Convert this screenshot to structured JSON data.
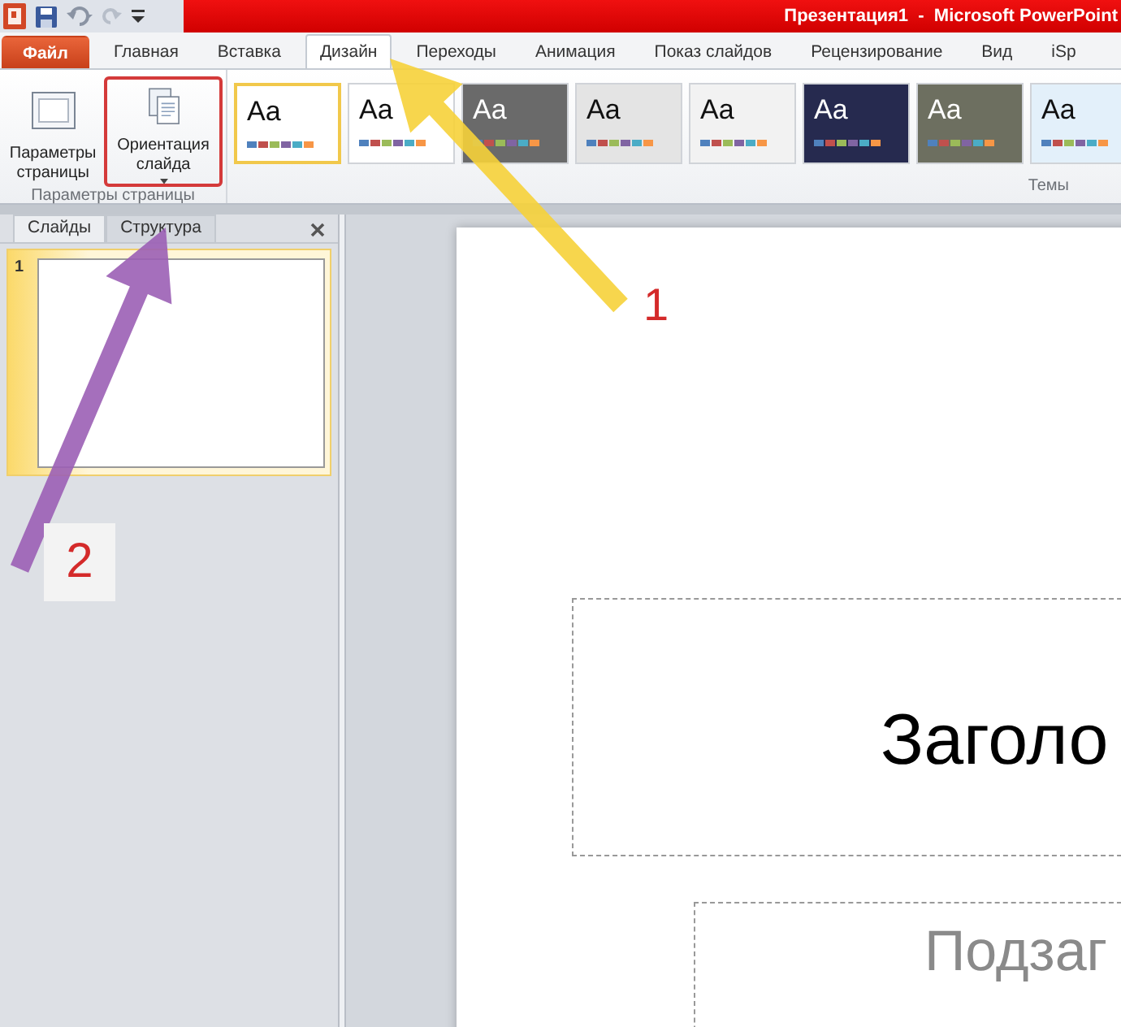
{
  "title_bar": {
    "title": "Презентация1  -  Microsoft PowerPoint"
  },
  "tabs": [
    {
      "label": "Файл",
      "kind": "file",
      "selected": false
    },
    {
      "label": "Главная",
      "kind": "tab",
      "selected": false
    },
    {
      "label": "Вставка",
      "kind": "tab",
      "selected": false
    },
    {
      "label": "Дизайн",
      "kind": "tab",
      "selected": true
    },
    {
      "label": "Переходы",
      "kind": "tab",
      "selected": false
    },
    {
      "label": "Анимация",
      "kind": "tab",
      "selected": false
    },
    {
      "label": "Показ слайдов",
      "kind": "tab",
      "selected": false
    },
    {
      "label": "Рецензирование",
      "kind": "tab",
      "selected": false
    },
    {
      "label": "Вид",
      "kind": "tab",
      "selected": false
    },
    {
      "label": "iSp",
      "kind": "tab",
      "selected": false
    }
  ],
  "ribbon": {
    "page_group": {
      "label": "Параметры страницы",
      "buttons": [
        {
          "label": "Параметры страницы",
          "kind": "page",
          "dropdown": false,
          "highlighted": false
        },
        {
          "label": "Ориентация слайда",
          "kind": "orientation",
          "dropdown": true,
          "highlighted": true
        }
      ]
    },
    "themes_group": {
      "label": "Темы",
      "themes": [
        {
          "sample": "Aa",
          "selected": true,
          "color": "#ffffff"
        },
        {
          "sample": "Aa",
          "selected": false,
          "color": "#ffffff"
        },
        {
          "sample": "Aa",
          "selected": false,
          "color": "#6a6a6a"
        },
        {
          "sample": "Aa",
          "selected": false,
          "color": "#e4e4e4"
        },
        {
          "sample": "Aa",
          "selected": false,
          "color": "#f2f2f2"
        },
        {
          "sample": "Aa",
          "selected": false,
          "color": "#262a4f"
        },
        {
          "sample": "Aa",
          "selected": false,
          "color": "#6d6f60"
        },
        {
          "sample": "Aa",
          "selected": false,
          "color": "#e3f0fa"
        }
      ]
    }
  },
  "slides_pane": {
    "tabs": [
      {
        "label": "Слайды",
        "selected": true
      },
      {
        "label": "Структура",
        "selected": false
      }
    ],
    "slides": [
      {
        "number": "1",
        "selected": true
      }
    ]
  },
  "slide": {
    "title_placeholder": "Заголо",
    "subtitle_placeholder": "Подзаг"
  },
  "annotations": [
    {
      "label": "1",
      "color": "#f6d23a"
    },
    {
      "label": "2",
      "color": "#9b5fb5"
    }
  ]
}
